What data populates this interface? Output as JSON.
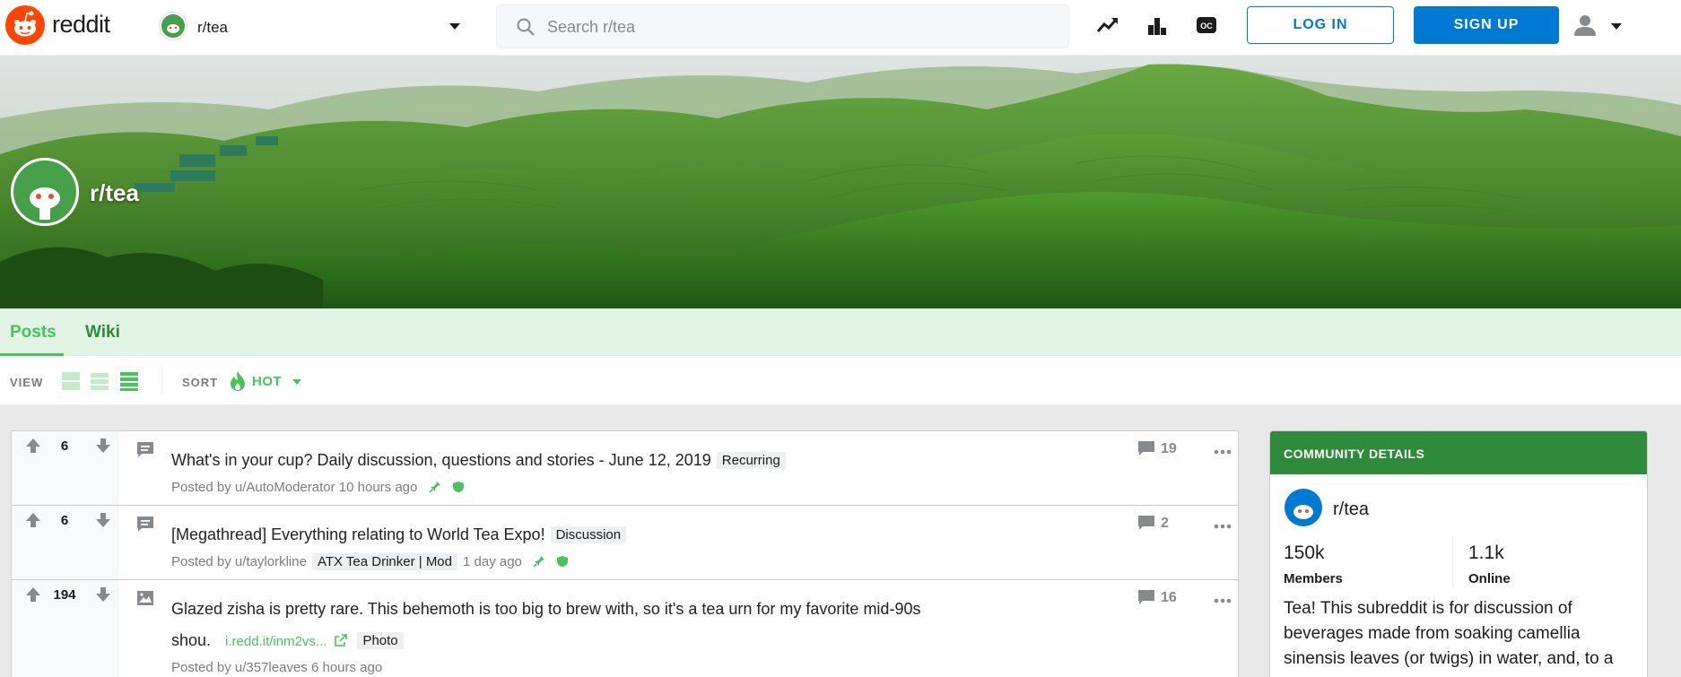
{
  "header": {
    "wordmark": "reddit",
    "community": "r/tea",
    "search_placeholder": "Search r/tea",
    "icons": [
      "trending-icon",
      "leaderboard-icon",
      "oc-icon"
    ],
    "login_label": "LOG IN",
    "signup_label": "SIGN UP",
    "brand_color": "#ff4500",
    "accent_color": "#0079d3"
  },
  "banner": {
    "title": "r/tea"
  },
  "tabs": [
    {
      "label": "Posts",
      "active": true
    },
    {
      "label": "Wiki",
      "active": false
    }
  ],
  "viewbar": {
    "view_label": "VIEW",
    "sort_label": "SORT",
    "sort_value": "HOT",
    "theme_color": "#46c35a"
  },
  "posts": [
    {
      "score": "6",
      "type": "text",
      "title": "What's in your cup? Daily discussion, questions and stories - June 12, 2019",
      "flair": "Recurring",
      "author_prefix": "Posted by",
      "author": "u/AutoModerator",
      "time": "10 hours ago",
      "comments": "19"
    },
    {
      "score": "6",
      "type": "text",
      "title": "[Megathread] Everything relating to World Tea Expo!",
      "flair": "Discussion",
      "author_prefix": "Posted by",
      "author": "u/taylorkline",
      "user_flair": "ATX Tea Drinker | Mod",
      "time": "1 day ago",
      "comments": "2"
    },
    {
      "score": "194",
      "type": "image",
      "title": "Glazed zisha is pretty rare. This behemoth is too big to brew with, so it's a tea urn for my favorite mid-90s",
      "title_cont": "shou.",
      "link": "i.redd.it/inm2vs...",
      "flair": "Photo",
      "author_prefix": "Posted by",
      "author": "u/357leaves",
      "time": "6 hours ago",
      "comments": "16"
    }
  ],
  "sidebar": {
    "heading": "COMMUNITY DETAILS",
    "name": "r/tea",
    "members_num": "150k",
    "members_label": "Members",
    "online_num": "1.1k",
    "online_label": "Online",
    "description": "Tea! This subreddit is for discussion of beverages made from soaking camellia sinensis leaves (or twigs) in water, and, to a",
    "header_color": "#2e8b3b"
  }
}
